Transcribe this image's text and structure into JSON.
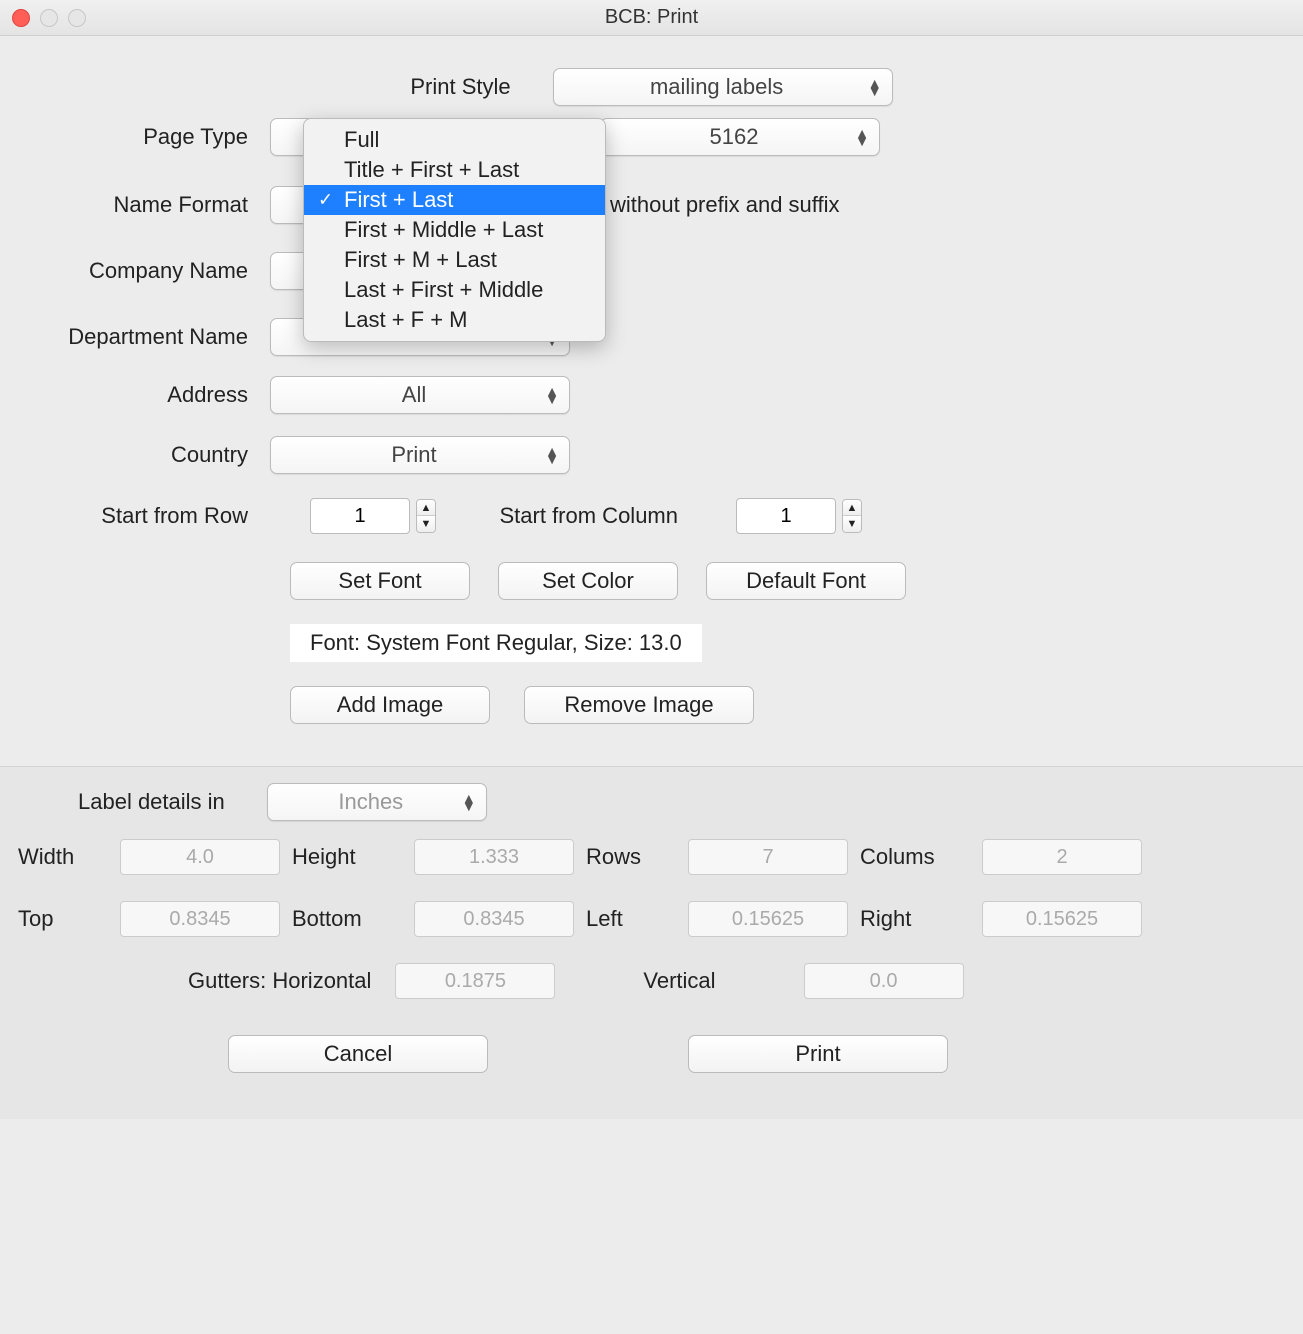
{
  "window": {
    "title": "BCB: Print"
  },
  "printStyle": {
    "label": "Print Style",
    "value": "mailing labels"
  },
  "pageType": {
    "label": "Page Type",
    "right_value": "5162"
  },
  "nameFormat": {
    "label": "Name Format",
    "note": "without prefix and suffix",
    "options": [
      "Full",
      "Title + First + Last",
      "First + Last",
      "First + Middle + Last",
      "First + M + Last",
      "Last + First + Middle",
      "Last + F + M"
    ],
    "selected": "First + Last"
  },
  "companyName": {
    "label": "Company Name"
  },
  "departmentName": {
    "label": "Department Name"
  },
  "address": {
    "label": "Address",
    "value": "All"
  },
  "country": {
    "label": "Country",
    "value": "Print"
  },
  "startRow": {
    "label": "Start from Row",
    "value": "1"
  },
  "startCol": {
    "label": "Start from Column",
    "value": "1"
  },
  "fontButtons": {
    "setFont": "Set Font",
    "setColor": "Set Color",
    "defaultFont": "Default Font"
  },
  "fontInfo": "Font: System Font Regular, Size: 13.0",
  "imageButtons": {
    "add": "Add Image",
    "remove": "Remove Image"
  },
  "labelDetails": {
    "label": "Label details in",
    "unit": "Inches"
  },
  "dims": {
    "widthLabel": "Width",
    "width": "4.0",
    "heightLabel": "Height",
    "height": "1.333",
    "rowsLabel": "Rows",
    "rows": "7",
    "columnsLabel": "Colums",
    "columns": "2",
    "topLabel": "Top",
    "top": "0.8345",
    "bottomLabel": "Bottom",
    "bottom": "0.8345",
    "leftLabel": "Left",
    "left": "0.15625",
    "rightLabel": "Right",
    "right": "0.15625"
  },
  "gutters": {
    "label": "Gutters: Horizontal",
    "h": "0.1875",
    "vLabel": "Vertical",
    "v": "0.0"
  },
  "footer": {
    "cancel": "Cancel",
    "print": "Print"
  }
}
